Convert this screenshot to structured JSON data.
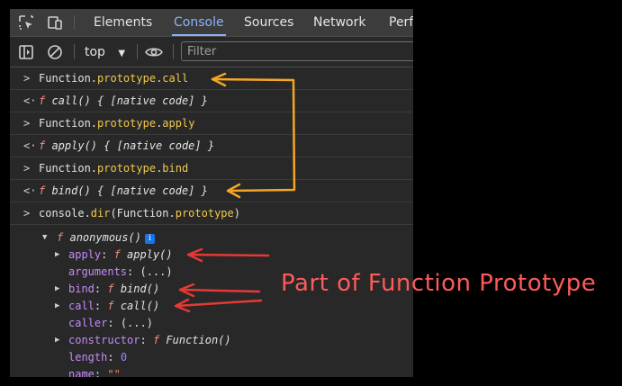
{
  "tabs": [
    "Elements",
    "Console",
    "Sources",
    "Network",
    "Perf"
  ],
  "active_tab": "Console",
  "filter_bar": {
    "context": "top",
    "filter_placeholder": "Filter"
  },
  "console_lines": [
    {
      "kind": "input",
      "prompt": ">",
      "parts": [
        "Function.",
        "prototype",
        ".",
        "call"
      ]
    },
    {
      "kind": "output",
      "prompt": "<·",
      "f": "f",
      "text": " call() { [native code] }"
    },
    {
      "kind": "input",
      "prompt": ">",
      "parts": [
        "Function.",
        "prototype",
        ".",
        "apply"
      ]
    },
    {
      "kind": "output",
      "prompt": "<·",
      "f": "f",
      "text": " apply() { [native code] }"
    },
    {
      "kind": "input",
      "prompt": ">",
      "parts": [
        "Function.",
        "prototype",
        ".",
        "bind"
      ]
    },
    {
      "kind": "output",
      "prompt": "<·",
      "f": "f",
      "text": " bind() { [native code] }"
    },
    {
      "kind": "input",
      "prompt": ">",
      "parts": [
        "console.",
        "dir",
        "(Function.",
        "prototype",
        ")"
      ]
    }
  ],
  "object_tree": {
    "root": {
      "f": "f",
      "name": "anonymous()",
      "info": "i"
    },
    "props": [
      {
        "expandable": true,
        "key": "apply",
        "sep": ": ",
        "f": "f",
        "value": "apply()"
      },
      {
        "expandable": false,
        "key": "arguments",
        "sep": ": ",
        "value": "(...)"
      },
      {
        "expandable": true,
        "key": "bind",
        "sep": ": ",
        "f": "f",
        "value": "bind()"
      },
      {
        "expandable": true,
        "key": "call",
        "sep": ": ",
        "f": "f",
        "value": "call()"
      },
      {
        "expandable": false,
        "key": "caller",
        "sep": ": ",
        "value": "(...)"
      },
      {
        "expandable": true,
        "key": "constructor",
        "sep": ": ",
        "f": "f",
        "value": "Function()"
      },
      {
        "expandable": false,
        "key": "length",
        "sep": ": ",
        "value": "0"
      },
      {
        "expandable": false,
        "key": "name",
        "sep": ": ",
        "value": "\"\""
      }
    ]
  },
  "annotation": {
    "text": "Part of Function Prototype",
    "color": "#ff5a5a"
  },
  "colors": {
    "accent": "#8ab4f8",
    "orange_arrow": "#f5a623",
    "red_arrow": "#e53935",
    "keyword_yellow": "#f2c94c",
    "property_purple": "#c58af9",
    "function_f": "#f28b82"
  }
}
